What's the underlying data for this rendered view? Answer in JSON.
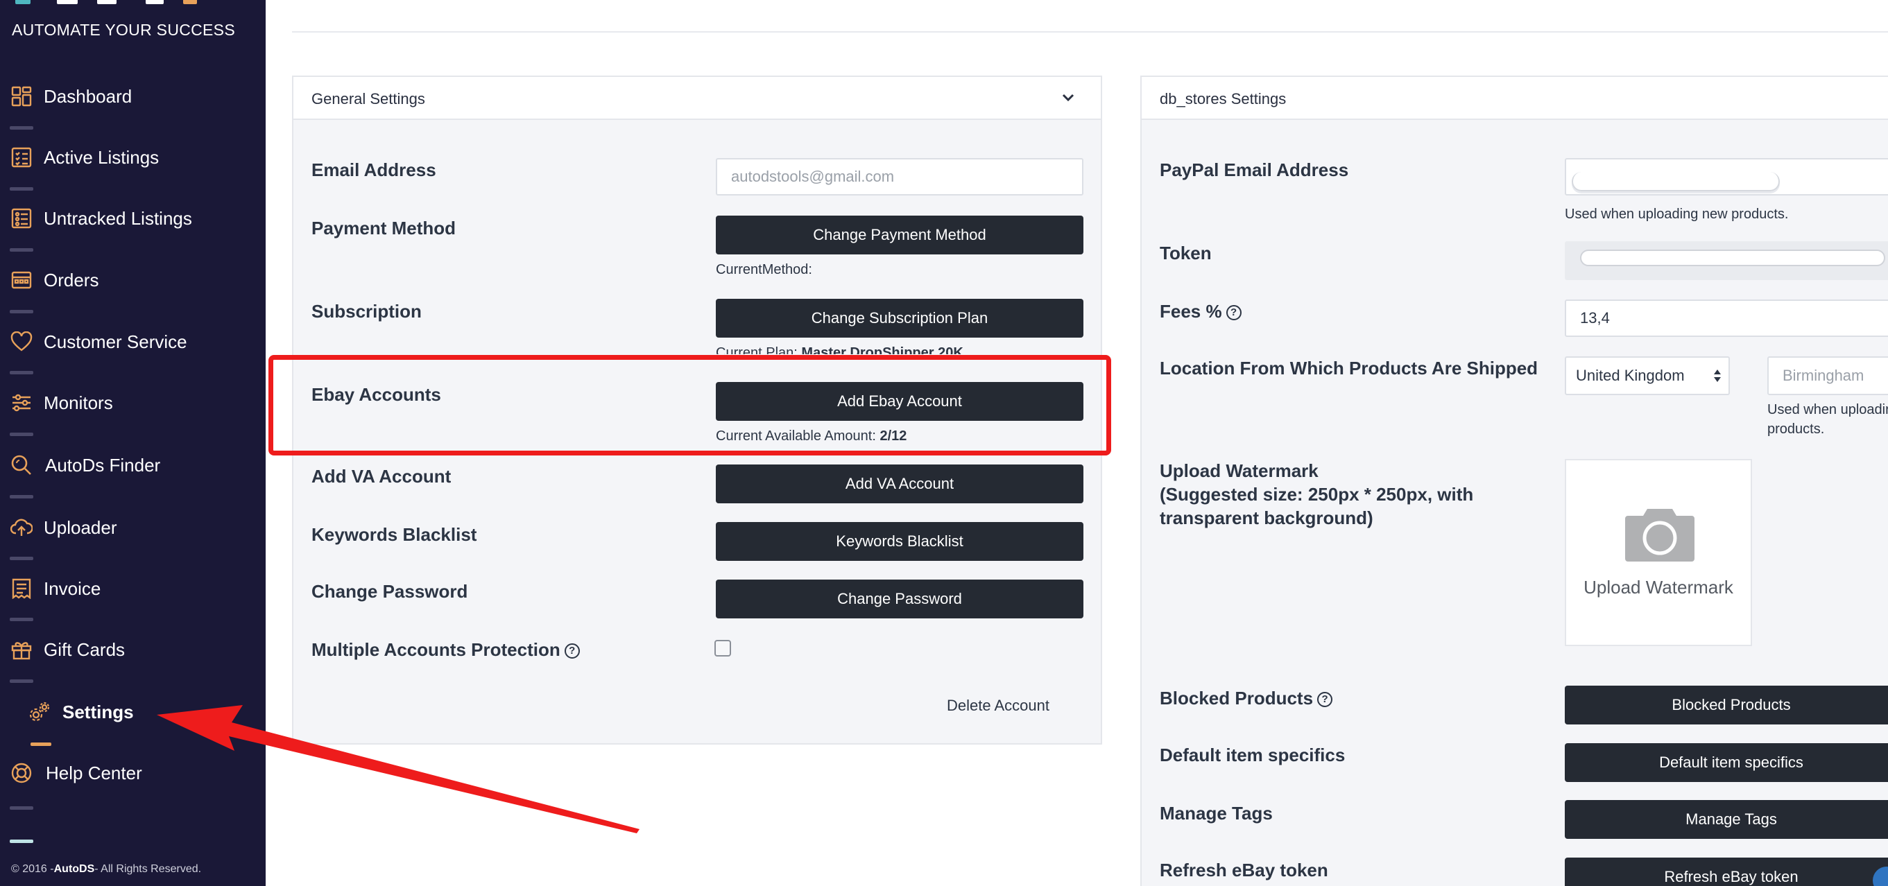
{
  "sidebar": {
    "tagline": "AUTOMATE YOUR SUCCESS",
    "items": [
      {
        "label": "Dashboard",
        "icon": "dashboard-icon"
      },
      {
        "label": "Active Listings",
        "icon": "checklist-icon"
      },
      {
        "label": "Untracked Listings",
        "icon": "list-icon"
      },
      {
        "label": "Orders",
        "icon": "orders-icon"
      },
      {
        "label": "Customer Service",
        "icon": "heart-icon"
      },
      {
        "label": "Monitors",
        "icon": "sliders-icon"
      },
      {
        "label": "AutoDs Finder",
        "icon": "search-icon"
      },
      {
        "label": "Uploader",
        "icon": "cloud-upload-icon"
      },
      {
        "label": "Invoice",
        "icon": "invoice-icon"
      },
      {
        "label": "Gift Cards",
        "icon": "gift-icon"
      },
      {
        "label": "Settings",
        "icon": "gears-icon"
      },
      {
        "label": "Help Center",
        "icon": "lifebuoy-icon"
      }
    ],
    "footer_prefix": "© 2016 -",
    "footer_brand": "AutoDS",
    "footer_suffix": "- All Rights Reserved."
  },
  "general_settings": {
    "title": "General Settings",
    "email_label": "Email Address",
    "email_placeholder": "autodstools@gmail.com",
    "payment_label": "Payment Method",
    "payment_button": "Change Payment Method",
    "current_method": "CurrentMethod:",
    "subscription_label": "Subscription",
    "subscription_button": "Change Subscription Plan",
    "current_plan_prefix": "Current Plan:",
    "current_plan_value": "Master DropShipper 20K",
    "ebay_label": "Ebay Accounts",
    "ebay_button": "Add Ebay Account",
    "available_prefix": "Current Available Amount:",
    "available_value": "2/12",
    "va_label": "Add VA Account",
    "va_button": "Add VA Account",
    "keywords_label": "Keywords Blacklist",
    "keywords_button": "Keywords Blacklist",
    "password_label": "Change Password",
    "password_button": "Change Password",
    "multi_label": "Multiple Accounts Protection",
    "delete_account": "Delete Account"
  },
  "store_settings": {
    "title": "db_stores Settings",
    "paypal_label": "PayPal Email Address",
    "paypal_hint": "Used when uploading new products.",
    "token_label": "Token",
    "fees_label": "Fees %",
    "fees_value": "13,4",
    "location_label": "Location From Which Products Are Shipped",
    "country_value": "United Kingdom",
    "city_placeholder": "Birmingham",
    "city_hint_1": "Used when uploadir",
    "city_hint_2": "products.",
    "watermark_label_1": "Upload Watermark",
    "watermark_label_2": "(Suggested size: 250px * 250px, with",
    "watermark_label_3": "transparent background)",
    "watermark_button": "Upload Watermark",
    "blocked_label": "Blocked Products",
    "blocked_button": "Blocked Products",
    "specifics_label": "Default item specifics",
    "specifics_button": "Default item specifics",
    "tags_label": "Manage Tags",
    "tags_button": "Manage Tags",
    "refresh_label": "Refresh eBay token",
    "refresh_button": "Refresh eBay token"
  },
  "colors": {
    "sidebar_bg": "#1a1837",
    "button_bg": "#252a33",
    "highlight": "#ee1c1c",
    "accent_orange": "#e8a15a"
  }
}
